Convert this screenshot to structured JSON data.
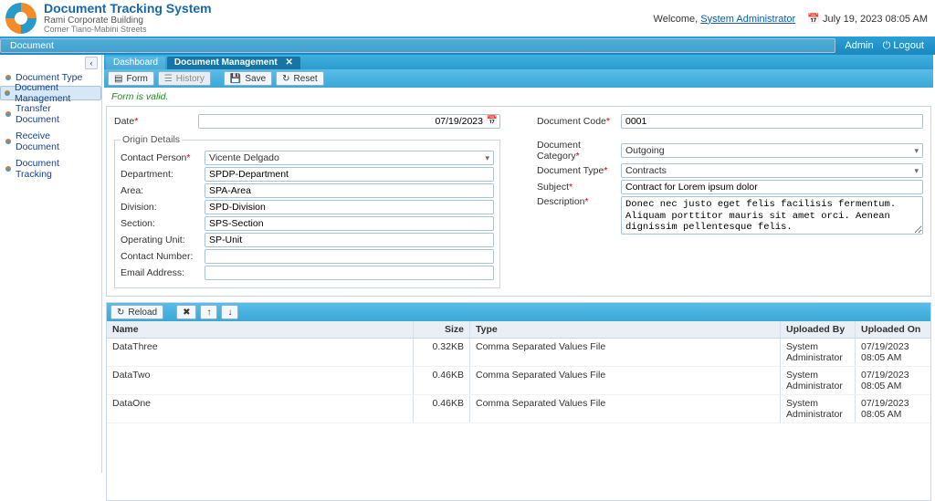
{
  "brand": {
    "title": "Document Tracking System",
    "subtitle": "Rami Corporate Building",
    "address": "Corner Tiano-Mabini Streets"
  },
  "header": {
    "welcome_prefix": "Welcome, ",
    "user": "System Administrator",
    "date": "July 19, 2023 08:05 AM",
    "logout": "Logout"
  },
  "topmenu": {
    "document": "Document",
    "admin": "Admin"
  },
  "sidebar": {
    "items": [
      {
        "label": "Document Type"
      },
      {
        "label": "Document Management"
      },
      {
        "label": "Transfer Document"
      },
      {
        "label": "Receive Document"
      },
      {
        "label": "Document Tracking"
      }
    ]
  },
  "tabs": {
    "dashboard": "Dashboard",
    "docmgmt": "Document Management"
  },
  "toolbar": {
    "form": "Form",
    "history": "History",
    "save": "Save",
    "reset": "Reset"
  },
  "status": {
    "valid": "Form is valid."
  },
  "form": {
    "date_label": "Date",
    "date_value": "07/19/2023",
    "origin_legend": "Origin Details",
    "contact_label": "Contact Person",
    "contact_value": "Vicente Delgado",
    "dept_label": "Department:",
    "dept_value": "SPDP-Department",
    "area_label": "Area:",
    "area_value": "SPA-Area",
    "div_label": "Division:",
    "div_value": "SPD-Division",
    "sec_label": "Section:",
    "sec_value": "SPS-Section",
    "unit_label": "Operating Unit:",
    "unit_value": "SP-Unit",
    "cnum_label": "Contact Number:",
    "cnum_value": "",
    "email_label": "Email Address:",
    "email_value": "",
    "code_label": "Document Code",
    "code_value": "0001",
    "cat_label": "Document Category",
    "cat_value": "Outgoing",
    "type_label": "Document Type",
    "type_value": "Contracts",
    "subj_label": "Subject",
    "subj_value": "Contract for Lorem ipsum dolor",
    "desc_label": "Description",
    "desc_value": "Donec nec justo eget felis facilisis fermentum. Aliquam porttitor mauris sit amet orci. Aenean dignissim pellentesque felis."
  },
  "grid": {
    "reload": "Reload",
    "headers": {
      "name": "Name",
      "size": "Size",
      "type": "Type",
      "upby": "Uploaded By",
      "upon": "Uploaded On"
    },
    "rows": [
      {
        "name": "DataThree",
        "size": "0.32KB",
        "type": "Comma Separated Values File",
        "upby": "System Administrator",
        "upon": "07/19/2023 08:05 AM"
      },
      {
        "name": "DataTwo",
        "size": "0.46KB",
        "type": "Comma Separated Values File",
        "upby": "System Administrator",
        "upon": "07/19/2023 08:05 AM"
      },
      {
        "name": "DataOne",
        "size": "0.46KB",
        "type": "Comma Separated Values File",
        "upby": "System Administrator",
        "upon": "07/19/2023 08:05 AM"
      }
    ]
  }
}
